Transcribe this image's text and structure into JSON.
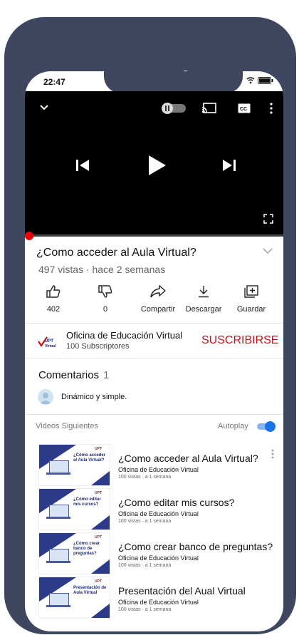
{
  "status_bar": {
    "time": "22:47"
  },
  "video": {
    "progress": 0.0
  },
  "title": "¿Como acceder al Aula Virtual?",
  "meta": "497 vistas · hace 2 semanas",
  "actions": [
    {
      "icon": "thumbs-up-icon",
      "label": "402"
    },
    {
      "icon": "thumbs-down-icon",
      "label": "0"
    },
    {
      "icon": "share-icon",
      "label": "Compartir"
    },
    {
      "icon": "download-icon",
      "label": "Descargar"
    },
    {
      "icon": "save-playlist-icon",
      "label": "Guardar"
    }
  ],
  "channel": {
    "name": "Oficina de Educación Virtual",
    "subscribers": "100 Subscriptores",
    "subscribe_label": "SUSCRIBIRSE"
  },
  "comments": {
    "title": "Comentarios",
    "count": "1",
    "first_comment": "Dinámico y simple."
  },
  "up_next": {
    "label": "Videos Siguientes",
    "autoplay_label": "Autoplay",
    "autoplay_on": true,
    "items": [
      {
        "title": "¿Como acceder al Aula Virtual?",
        "thumb_text": "¿Cómo acceder al Aula Virtual?",
        "channel": "Oficina de Educación Virtual",
        "meta": "100 vistas · a 1 semana"
      },
      {
        "title": "¿Como editar mis cursos?",
        "thumb_text": "¿Cómo editar mis cursos?",
        "channel": "Oficina de Educación Virtual",
        "meta": "100 vistas · a 1 semana"
      },
      {
        "title": "¿Como crear banco de preguntas?",
        "thumb_text": "¿Cómo crear banco de preguntas?",
        "channel": "Oficina de Educación Virtual",
        "meta": "100 vistas · a 1 semana"
      },
      {
        "title": "Presentación del Aual Virtual",
        "thumb_text": "Presentación de Aula Virtual",
        "channel": "Oficina de Educación Virtual",
        "meta": "100 vistas · a 1 semana"
      }
    ]
  },
  "colors": {
    "frame": "#3f4660",
    "accent_red": "#c4141b",
    "toggle_blue": "#1a73e8"
  }
}
